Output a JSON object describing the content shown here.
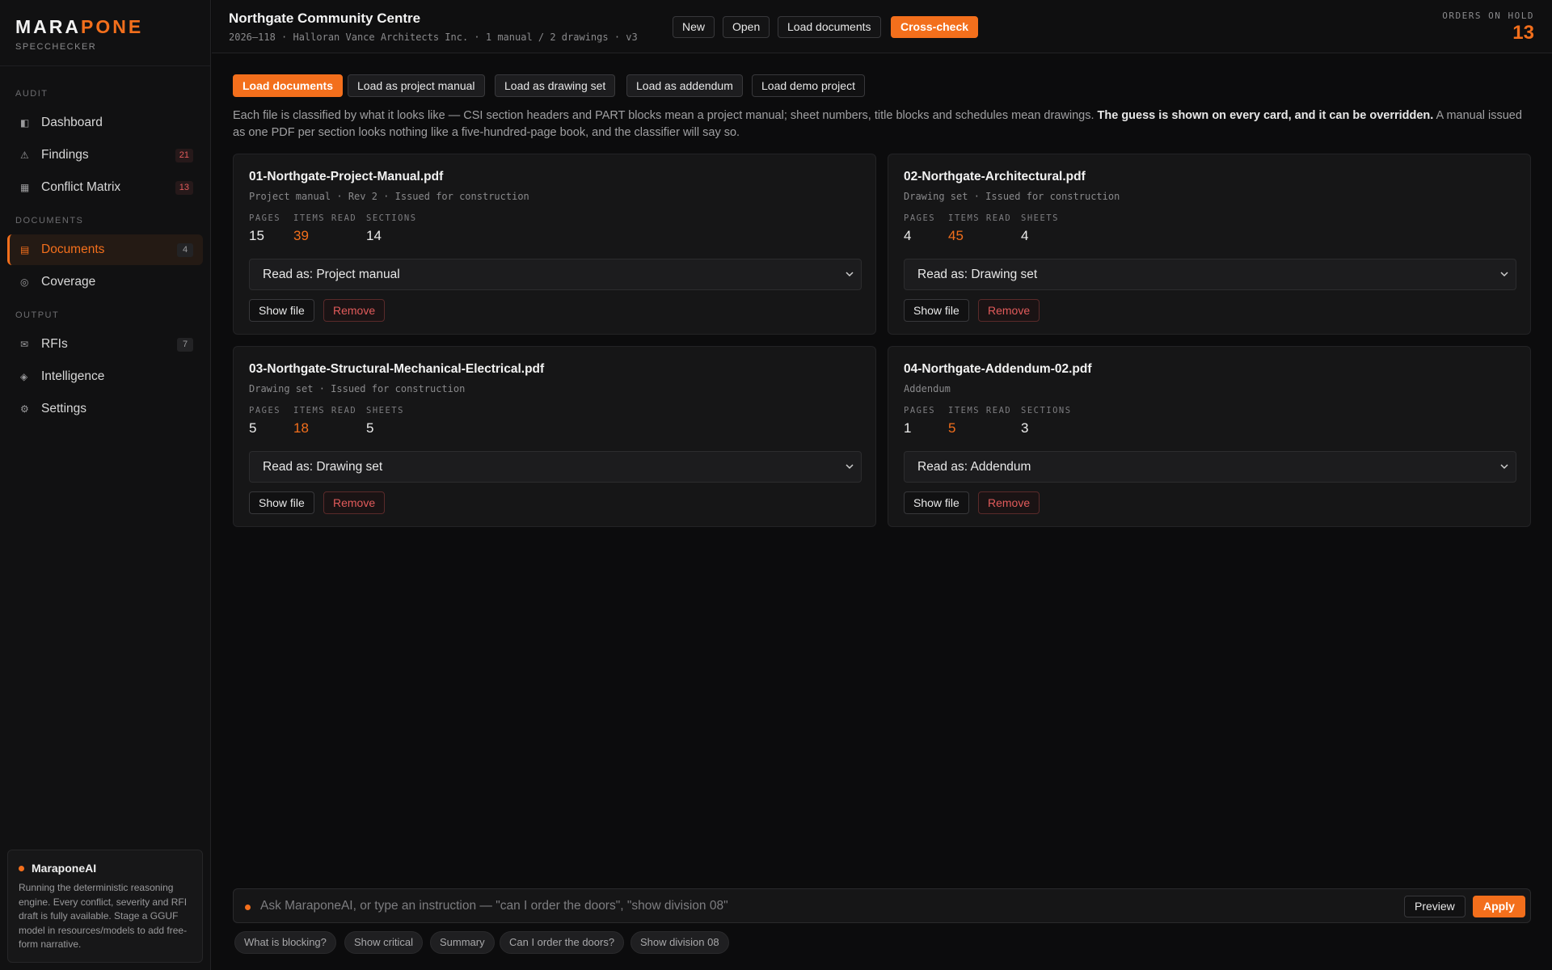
{
  "brand": {
    "name_a": "MARA",
    "name_b": "PONE",
    "subtitle": "SPECCHECKER"
  },
  "sidebar": {
    "sections": [
      "AUDIT",
      "DOCUMENTS",
      "OUTPUT"
    ],
    "items": [
      {
        "label": "Dashboard",
        "icon": "dashboard-icon",
        "badge": ""
      },
      {
        "label": "Findings",
        "icon": "warning-icon",
        "badge": "21"
      },
      {
        "label": "Conflict Matrix",
        "icon": "grid-icon",
        "badge": "13"
      },
      {
        "label": "Documents",
        "icon": "documents-icon",
        "badge": "4"
      },
      {
        "label": "Coverage",
        "icon": "target-icon",
        "badge": ""
      },
      {
        "label": "RFIs",
        "icon": "mail-icon",
        "badge": "7"
      },
      {
        "label": "Intelligence",
        "icon": "diamond-icon",
        "badge": ""
      },
      {
        "label": "Settings",
        "icon": "gear-icon",
        "badge": ""
      }
    ],
    "ai": {
      "title": "MaraponeAI",
      "text": "Running the deterministic reasoning engine. Every conflict, severity and RFI draft is fully available. Stage a GGUF model in resources/models to add free-form narrative."
    }
  },
  "header": {
    "title": "Northgate Community Centre",
    "meta": "2026–118 · Halloran Vance Architects Inc. · 1 manual / 2 drawings · v3",
    "buttons": {
      "new": "New",
      "open": "Open",
      "load": "Load documents",
      "cross": "Cross-check"
    },
    "hold_label": "ORDERS ON HOLD",
    "hold_value": "13"
  },
  "toolbar": {
    "load": "Load documents",
    "manual": "Load as project manual",
    "drawing": "Load as drawing set",
    "addendum": "Load as addendum",
    "demo": "Load demo project"
  },
  "intro": {
    "text1": "Each file is classified by what it looks like — CSI section headers and PART blocks mean a project manual; sheet numbers, title blocks and schedules mean drawings. ",
    "bold": "The guess is shown on every card, and it can be overridden.",
    "text2": " A manual issued as one PDF per section looks nothing like a five-hundred-page book, and the classifier will say so."
  },
  "cards": [
    {
      "name": "01-Northgate-Project-Manual.pdf",
      "type": "Project manual · Rev 2 · Issued for construction",
      "pages_label": "PAGES",
      "pages": "15",
      "items_label": "ITEMS READ",
      "items": "39",
      "third_label": "SECTIONS",
      "third": "14",
      "read_as": "Read as: Project manual",
      "show": "Show file",
      "remove": "Remove"
    },
    {
      "name": "02-Northgate-Architectural.pdf",
      "type": "Drawing set · Issued for construction",
      "pages_label": "PAGES",
      "pages": "4",
      "items_label": "ITEMS READ",
      "items": "45",
      "third_label": "SHEETS",
      "third": "4",
      "read_as": "Read as: Drawing set",
      "show": "Show file",
      "remove": "Remove"
    },
    {
      "name": "03-Northgate-Structural-Mechanical-Electrical.pdf",
      "type": "Drawing set · Issued for construction",
      "pages_label": "PAGES",
      "pages": "5",
      "items_label": "ITEMS READ",
      "items": "18",
      "third_label": "SHEETS",
      "third": "5",
      "read_as": "Read as: Drawing set",
      "show": "Show file",
      "remove": "Remove"
    },
    {
      "name": "04-Northgate-Addendum-02.pdf",
      "type": "Addendum",
      "pages_label": "PAGES",
      "pages": "1",
      "items_label": "ITEMS READ",
      "items": "5",
      "third_label": "SECTIONS",
      "third": "3",
      "read_as": "Read as: Addendum",
      "show": "Show file",
      "remove": "Remove"
    }
  ],
  "ask": {
    "placeholder": "Ask MaraponeAI, or type an instruction — \"can I order the doors\", \"show division 08\"",
    "preview": "Preview",
    "apply": "Apply",
    "chips": [
      "What is blocking?",
      "Show critical",
      "Summary",
      "Can I order the doors?",
      "Show division 08"
    ]
  },
  "colors": {
    "accent": "#f36f1c",
    "danger": "#e25b5b",
    "background": "#0c0c0d"
  }
}
